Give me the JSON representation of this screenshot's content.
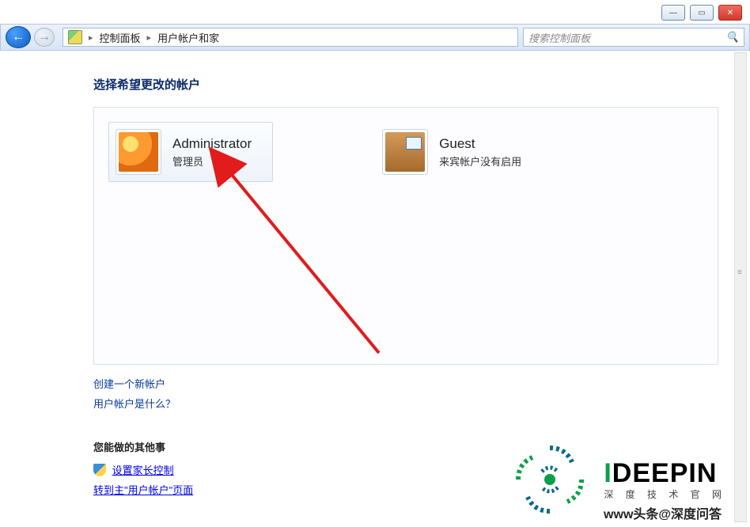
{
  "window_controls": {
    "minimize": "—",
    "maximize": "▭",
    "close": "✕"
  },
  "nav": {
    "back": "←",
    "forward": "→"
  },
  "breadcrumb": {
    "item1": "控制面板",
    "item2": "用户帐户和家",
    "sep": "▸"
  },
  "search": {
    "placeholder": "搜索控制面板",
    "icon": "🔍"
  },
  "page_title": "选择希望更改的帐户",
  "accounts": [
    {
      "name": "Administrator",
      "role": "管理员"
    },
    {
      "name": "Guest",
      "role": "来宾帐户没有启用"
    }
  ],
  "links": {
    "create": "创建一个新帐户",
    "whatis": "用户帐户是什么？"
  },
  "extra": {
    "heading": "您能做的其他事",
    "parental": "设置家长控制",
    "goto_main": "转到主\"用户帐户\"页面"
  },
  "watermark": {
    "brand_i": "I",
    "brand_rest": "DEEPIN",
    "sub": "深  度  技  术  官  网",
    "credit": "www头条@深度问答"
  }
}
